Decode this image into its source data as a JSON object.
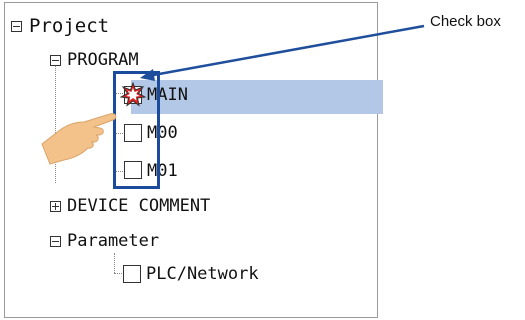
{
  "tree": {
    "root": {
      "label": "Project",
      "expanded": true
    },
    "program": {
      "label": "PROGRAM",
      "expanded": true,
      "items": [
        {
          "label": "MAIN",
          "selected": true,
          "checked": true
        },
        {
          "label": "M00",
          "selected": false,
          "checked": false
        },
        {
          "label": "M01",
          "selected": false,
          "checked": false
        }
      ]
    },
    "device_comment": {
      "label": "DEVICE COMMENT",
      "expanded": false
    },
    "parameter": {
      "label": "Parameter",
      "expanded": true,
      "items": [
        {
          "label": "PLC/Network",
          "checked": false
        }
      ]
    }
  },
  "annotation": {
    "callout_text": "Check box"
  },
  "colors": {
    "selection": "#b3c7e6",
    "frame": "#1b4b9c",
    "callout_arrow": "#1f4e9c",
    "hand": "#f2c28a",
    "star_mark": "#e02020"
  },
  "icons": [
    "collapse-icon",
    "expand-icon",
    "checkbox-icon",
    "pointing-hand-icon",
    "arrow-icon"
  ]
}
